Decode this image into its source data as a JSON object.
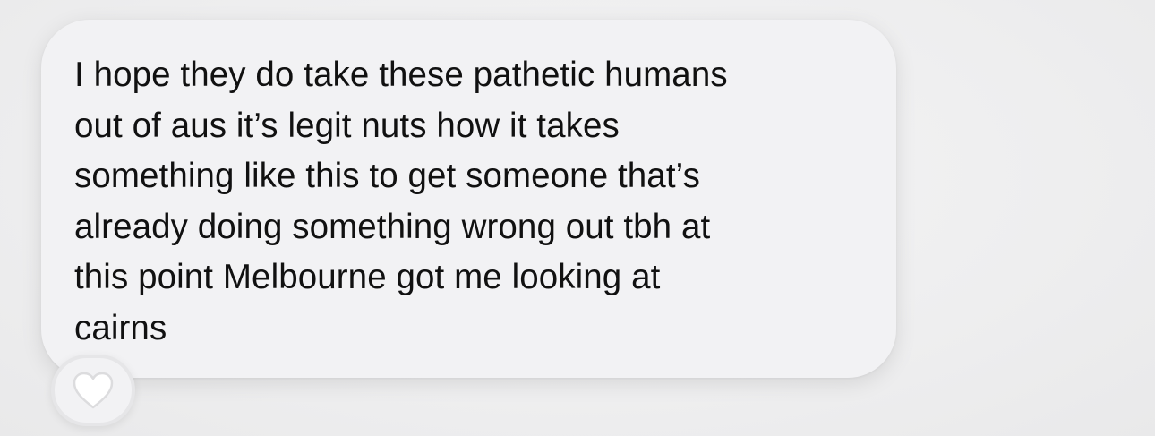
{
  "message": {
    "text": "I hope they do take these pathetic humans\nout of aus it’s legit nuts how it takes\nsomething like this to get someone that’s\nalready doing something wrong out tbh at\nthis point Melbourne got me looking at\ncairns"
  },
  "reaction": {
    "icon": "heart-icon",
    "color": "#ffffff"
  },
  "colors": {
    "bubble": "#f2f2f4",
    "text": "#111111",
    "background": "#f0f0f0"
  }
}
